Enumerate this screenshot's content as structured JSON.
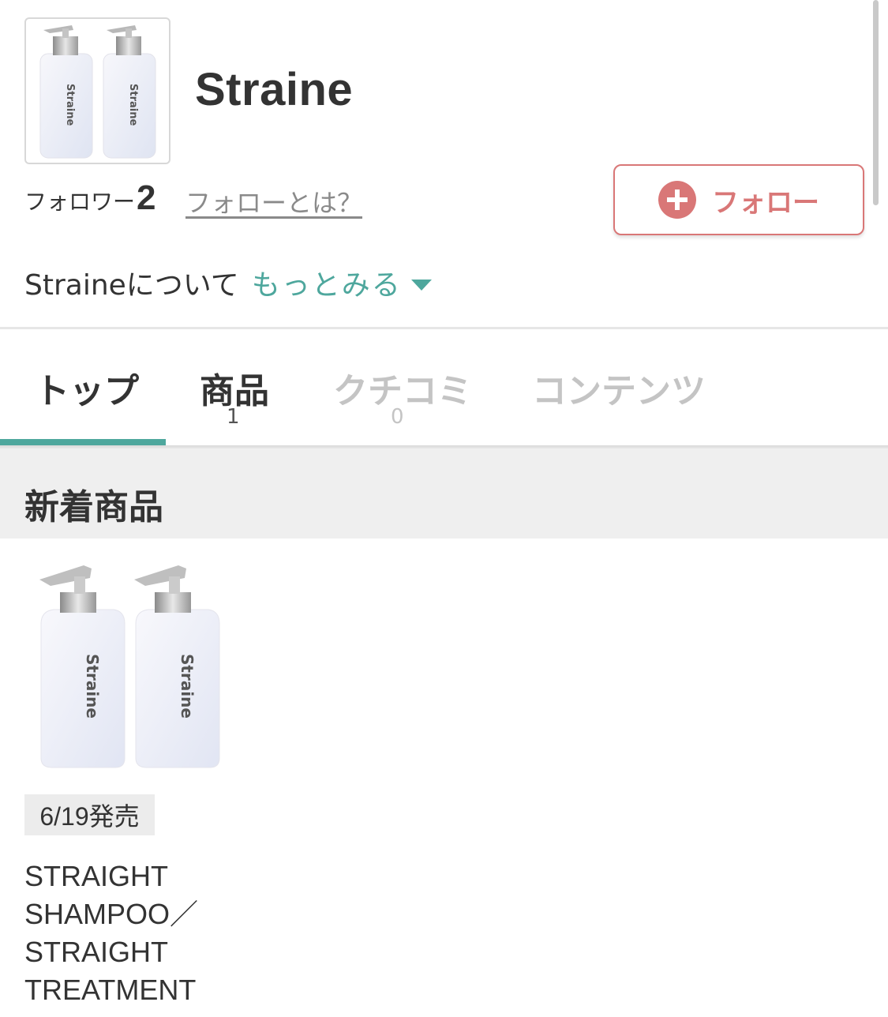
{
  "brand": {
    "name": "Straine",
    "logo_icon": "shampoo-bottles-image",
    "bottle_text": "Straine"
  },
  "followers": {
    "label": "フォロワー",
    "count": "2",
    "help_link": "フォローとは？"
  },
  "follow_button": {
    "icon": "plus-circle-icon",
    "label": "フォロー"
  },
  "about": {
    "text": "Straineについて",
    "more_link": "もっとみる",
    "icon": "caret-down-icon"
  },
  "tabs": [
    {
      "label": "トップ",
      "count": "",
      "active": true
    },
    {
      "label": "商品",
      "count": "1",
      "active": false
    },
    {
      "label": "クチコミ",
      "count": "0",
      "active": false,
      "disabled": true
    },
    {
      "label": "コンテンツ",
      "count": "",
      "active": false,
      "disabled": true
    }
  ],
  "section": {
    "title": "新着商品"
  },
  "product": {
    "release": "6/19発売",
    "name": "STRAIGHT\nSHAMPOO／\nSTRAIGHT\nTREATMENT"
  },
  "colors": {
    "accent_teal": "#4ea79d",
    "follow_red": "#d97777",
    "text_dark": "#333333",
    "tab_inactive": "#bdbdbd"
  }
}
